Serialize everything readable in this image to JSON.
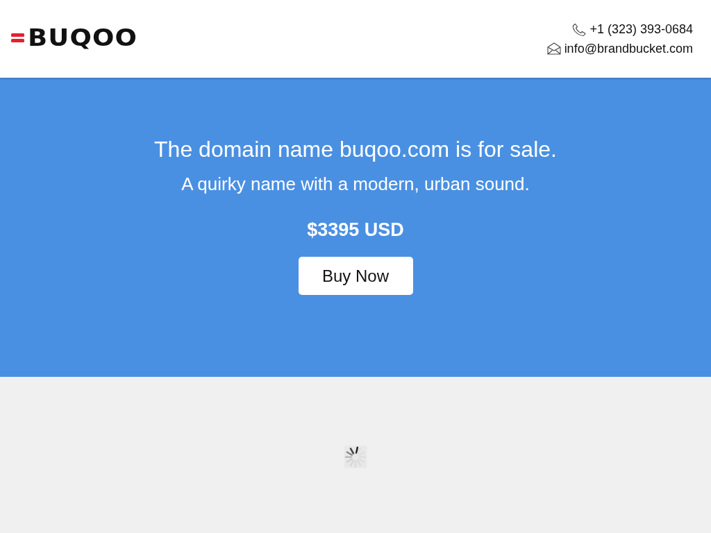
{
  "header": {
    "logo": {
      "text": "BUQOO"
    },
    "contact": {
      "phone": "+1 (323) 393-0684",
      "email": "info@brandbucket.com"
    }
  },
  "hero": {
    "title": "The domain name buqoo.com is for sale.",
    "tagline": "A quirky name with a modern, urban sound.",
    "price": "$3395 USD",
    "button": "Buy Now"
  },
  "content": {
    "loading": true
  }
}
